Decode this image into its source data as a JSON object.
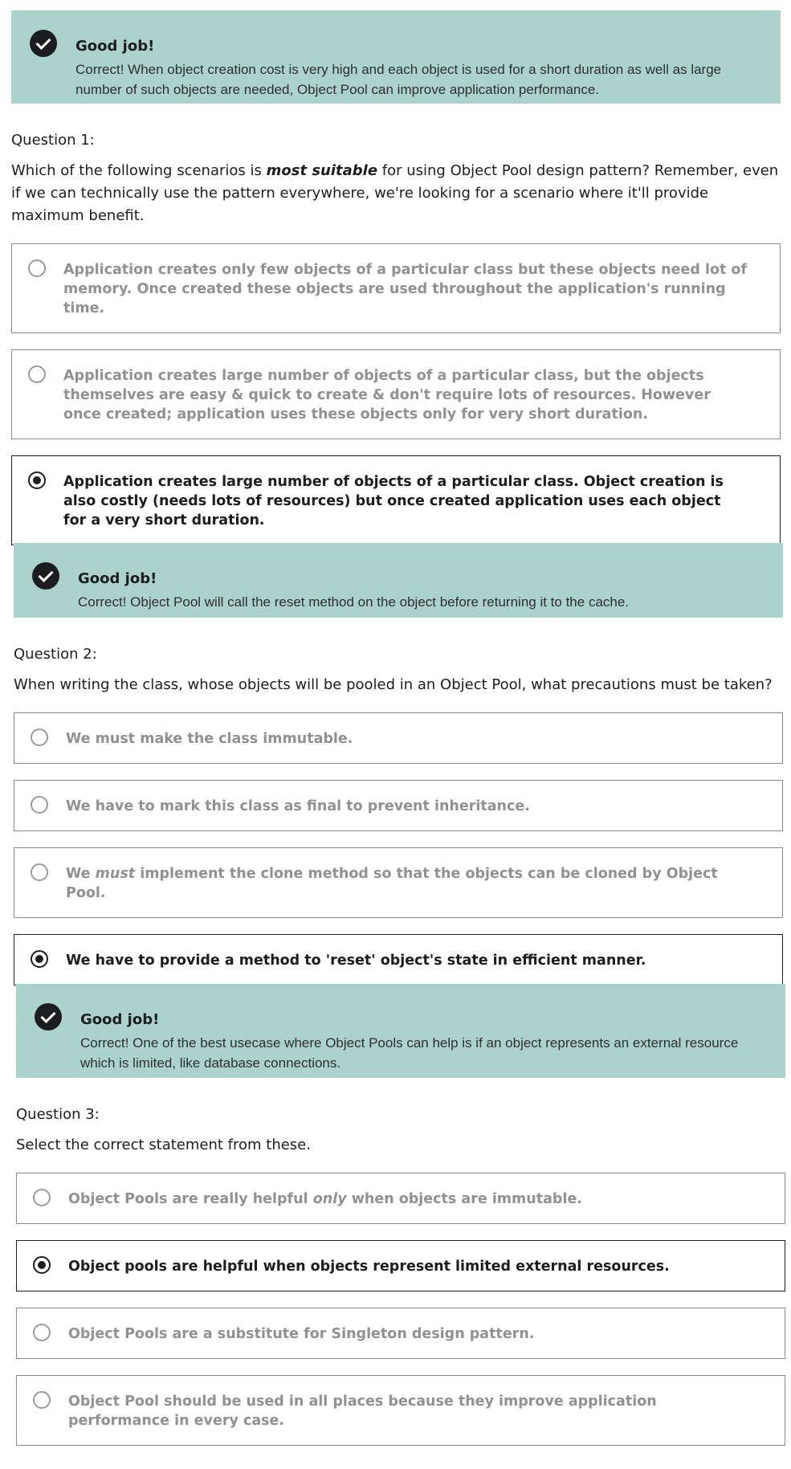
{
  "feedback1": {
    "title": "Good job!",
    "text": "Correct! When object creation cost is very high and each object is used for a short duration as well as large number of such objects are needed, Object Pool can improve application performance."
  },
  "q1": {
    "label": "Question 1:",
    "text_before": "Which of the following scenarios is ",
    "text_emphasis": "most suitable",
    "text_after": " for using Object Pool design pattern? Remember, even if we can technically use the pattern everywhere, we're looking for a scenario where it'll provide maximum benefit.",
    "answers": [
      {
        "text": "Application creates only few objects of a particular class but these objects need lot of memory. Once created these objects are used throughout the application's running time."
      },
      {
        "text": "Application creates large number of objects of a particular class, but the objects themselves are easy & quick to create & don't require lots of resources. However once created; application uses these objects only for very short duration."
      },
      {
        "text": "Application creates large number of objects of a particular class. Object creation is also costly (needs lots of resources) but once created application uses each object for a very short duration."
      }
    ],
    "selected_index": 2
  },
  "feedback2": {
    "title": "Good job!",
    "text": "Correct! Object Pool will call the reset method on the object before returning it to the cache."
  },
  "q2": {
    "label": "Question 2:",
    "text": "When writing the class, whose objects will be pooled in an Object Pool, what precautions must be taken?",
    "answers": [
      {
        "text": "We must make the class immutable."
      },
      {
        "text": "We have to mark this class as final to prevent inheritance."
      },
      {
        "pre": "We ",
        "em": "must",
        "post": " implement the clone method so that the objects can be cloned by Object Pool."
      },
      {
        "text": "We have to provide a method to 'reset' object's state in efficient manner."
      }
    ],
    "selected_index": 3
  },
  "feedback3": {
    "title": "Good job!",
    "text": "Correct! One of the best usecase where Object Pools can help is if an object represents an external resource which is limited, like database connections."
  },
  "q3": {
    "label": "Question 3:",
    "text": "Select the correct statement from these.",
    "answers": [
      {
        "pre": "Object Pools are really helpful ",
        "em": "only",
        "post": " when objects are immutable."
      },
      {
        "text": "Object pools are helpful when objects represent limited external resources."
      },
      {
        "text": "Object Pools are a substitute for Singleton design pattern."
      },
      {
        "text": "Object Pool should be used in all places because they improve application performance in every case."
      }
    ],
    "selected_index": 1
  }
}
